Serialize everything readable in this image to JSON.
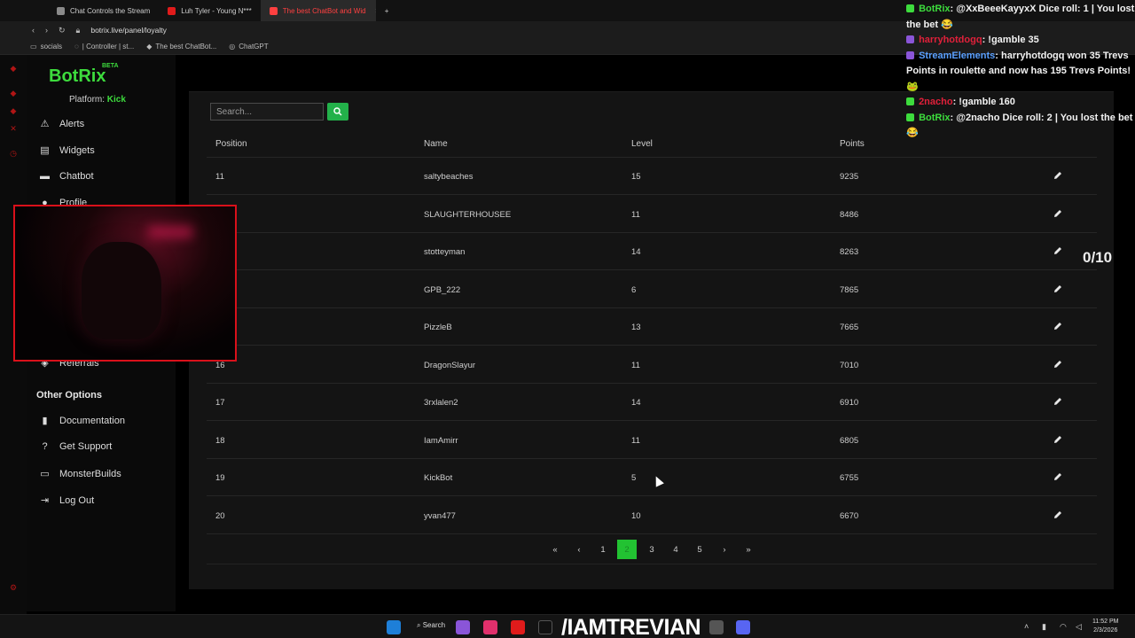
{
  "browser": {
    "tabs": [
      {
        "label": "Chat Controls the Stream",
        "color": "#8a8a8a"
      },
      {
        "label": "Luh Tyler - Young N***",
        "color": "#e01b1b"
      },
      {
        "label": "The best ChatBot and Wid",
        "color": "#ff4040"
      }
    ],
    "url": "botrix.live/panel/loyalty",
    "bookmarks": [
      "socials",
      "| Controller | st...",
      "The best ChatBot...",
      "ChatGPT"
    ]
  },
  "sidebar": {
    "logo": "BotRix",
    "beta": "BETA",
    "platform_label": "Platform:",
    "platform_value": "Kick",
    "items": [
      {
        "label": "Alerts",
        "icon": "warning-icon"
      },
      {
        "label": "Widgets",
        "icon": "widgets-icon"
      },
      {
        "label": "Chatbot",
        "icon": "chat-icon"
      },
      {
        "label": "Profile",
        "icon": "user-icon"
      },
      {
        "label": "Referrals",
        "icon": "referral-icon"
      }
    ],
    "other_title": "Other Options",
    "other_items": [
      {
        "label": "Documentation",
        "icon": "book-icon"
      },
      {
        "label": "Get Support",
        "icon": "question-icon"
      },
      {
        "label": "MonsterBuilds",
        "icon": "laptop-icon"
      },
      {
        "label": "Log Out",
        "icon": "logout-icon"
      }
    ]
  },
  "table": {
    "search_placeholder": "Search...",
    "headers": [
      "Position",
      "Name",
      "Level",
      "Points"
    ],
    "rows": [
      {
        "position": "11",
        "name": "saltybeaches",
        "level": "15",
        "points": "9235"
      },
      {
        "position": "",
        "name": "SLAUGHTERHOUSEE",
        "level": "11",
        "points": "8486"
      },
      {
        "position": "",
        "name": "stotteyman",
        "level": "14",
        "points": "8263"
      },
      {
        "position": "",
        "name": "GPB_222",
        "level": "6",
        "points": "7865"
      },
      {
        "position": "",
        "name": "PizzleB",
        "level": "13",
        "points": "7665"
      },
      {
        "position": "16",
        "name": "DragonSlayur",
        "level": "11",
        "points": "7010"
      },
      {
        "position": "17",
        "name": "3rxlalen2",
        "level": "14",
        "points": "6910"
      },
      {
        "position": "18",
        "name": "IamAmirr",
        "level": "11",
        "points": "6805"
      },
      {
        "position": "19",
        "name": "KickBot",
        "level": "5",
        "points": "6755"
      },
      {
        "position": "20",
        "name": "yvan477",
        "level": "10",
        "points": "6670"
      }
    ],
    "pager": {
      "first": "«",
      "prev": "‹",
      "pages": [
        "1",
        "2",
        "3",
        "4",
        "5"
      ],
      "current": "2",
      "next": "›",
      "last": "»"
    }
  },
  "chat": [
    {
      "user": "BotRix",
      "user_color": "#3ddc3d",
      "text": ": @XxBeeeKayyxX Dice roll: 1 | You lost the bet 😂"
    },
    {
      "user": "harryhotdogq",
      "user_color": "#e0203a",
      "text": ": !gamble 35"
    },
    {
      "user": "StreamElements",
      "user_color": "#5aa0ff",
      "text": ": harryhotdogq won 35 Trevs Points in roulette and now has 195 Trevs Points! 🐸"
    },
    {
      "user": "2nacho",
      "user_color": "#e0203a",
      "text": ": !gamble 160"
    },
    {
      "user": "BotRix",
      "user_color": "#3ddc3d",
      "text": ": @2nacho Dice roll: 2 | You lost the bet 😂"
    }
  ],
  "counter": "0/10",
  "taskbar": {
    "search": "Search",
    "brand": "/IAMTREVIAN",
    "time": "11:52 PM",
    "date": "2/3/2026"
  },
  "colors": {
    "accent": "#23b14a",
    "cam_border": "#d9101a"
  }
}
